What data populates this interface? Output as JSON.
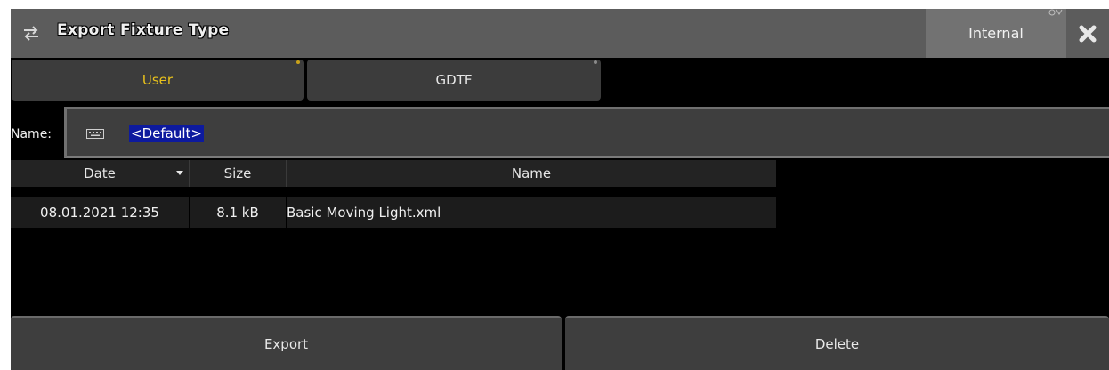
{
  "window": {
    "title": "Export Fixture Type",
    "internal_label": "Internal"
  },
  "tabs": [
    {
      "label": "User",
      "active": true
    },
    {
      "label": "GDTF",
      "active": false
    }
  ],
  "name_field": {
    "label": "Name:",
    "value": "<Default>"
  },
  "table": {
    "columns": [
      "Date",
      "Size",
      "Name"
    ],
    "sort_column": "Date",
    "rows": [
      {
        "date": "08.01.2021 12:35",
        "size": "8.1 kB",
        "name": "Basic Moving Light.xml"
      }
    ]
  },
  "buttons": {
    "export_label": "Export",
    "delete_label": "Delete"
  },
  "icons": {
    "title": "swap-arrows-icon",
    "close": "close-x-icon",
    "drag": "drag-handle-icon",
    "keyboard": "keyboard-icon",
    "sort": "sort-down-icon"
  },
  "colors": {
    "active_tab_text": "#e8c11c",
    "selection": "#0d1a9e",
    "titlebar": "#5c5c5c"
  }
}
